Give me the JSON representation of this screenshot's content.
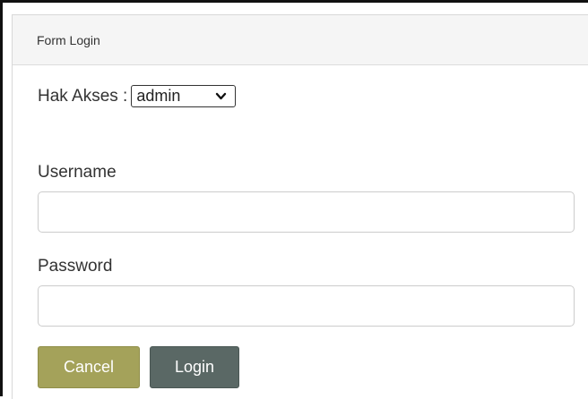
{
  "panel": {
    "title": "Form Login"
  },
  "access": {
    "label": "Hak Akses :",
    "selected": "admin"
  },
  "username": {
    "label": "Username",
    "value": "",
    "placeholder": ""
  },
  "password": {
    "label": "Password",
    "value": "",
    "placeholder": ""
  },
  "buttons": {
    "cancel": "Cancel",
    "login": "Login"
  },
  "colors": {
    "cancel_bg": "#a4a25a",
    "login_bg": "#5a6865",
    "header_bg": "#f5f5f5"
  },
  "icons": {
    "select_arrow": "chevron-down-icon"
  }
}
